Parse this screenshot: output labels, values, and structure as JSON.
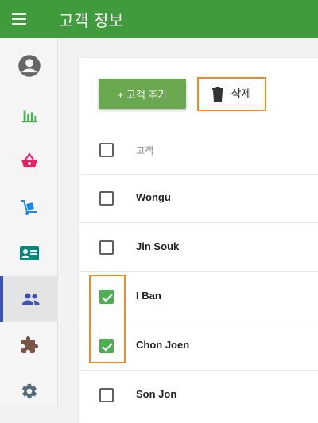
{
  "appbar": {
    "title": "고객 정보",
    "color": "#3f9b3c"
  },
  "sidebar": {
    "items": [
      {
        "icon": "account-circle-icon",
        "color": "#666666"
      },
      {
        "icon": "bar-chart-icon",
        "color": "#4caf50"
      },
      {
        "icon": "shopping-basket-icon",
        "color": "#e91e63"
      },
      {
        "icon": "hand-truck-icon",
        "color": "#1e88e5"
      },
      {
        "icon": "contact-card-icon",
        "color": "#00897b"
      },
      {
        "icon": "people-icon",
        "color": "#3f51b5",
        "active": true
      },
      {
        "icon": "puzzle-icon",
        "color": "#795548"
      },
      {
        "icon": "gear-icon",
        "color": "#546e7a"
      }
    ]
  },
  "toolbar": {
    "add_label": "+ 고객 추가",
    "delete_label": "삭제"
  },
  "table": {
    "header": "고객",
    "rows": [
      {
        "name": "Wongu",
        "checked": false
      },
      {
        "name": "Jin Souk",
        "checked": false
      },
      {
        "name": "I Ban",
        "checked": true
      },
      {
        "name": "Chon Joen",
        "checked": true
      },
      {
        "name": "Son Jon",
        "checked": false
      }
    ]
  },
  "colors": {
    "accent_green": "#6aa84f",
    "highlight_orange": "#f08a24",
    "checkbox_checked": "#4caf50"
  }
}
